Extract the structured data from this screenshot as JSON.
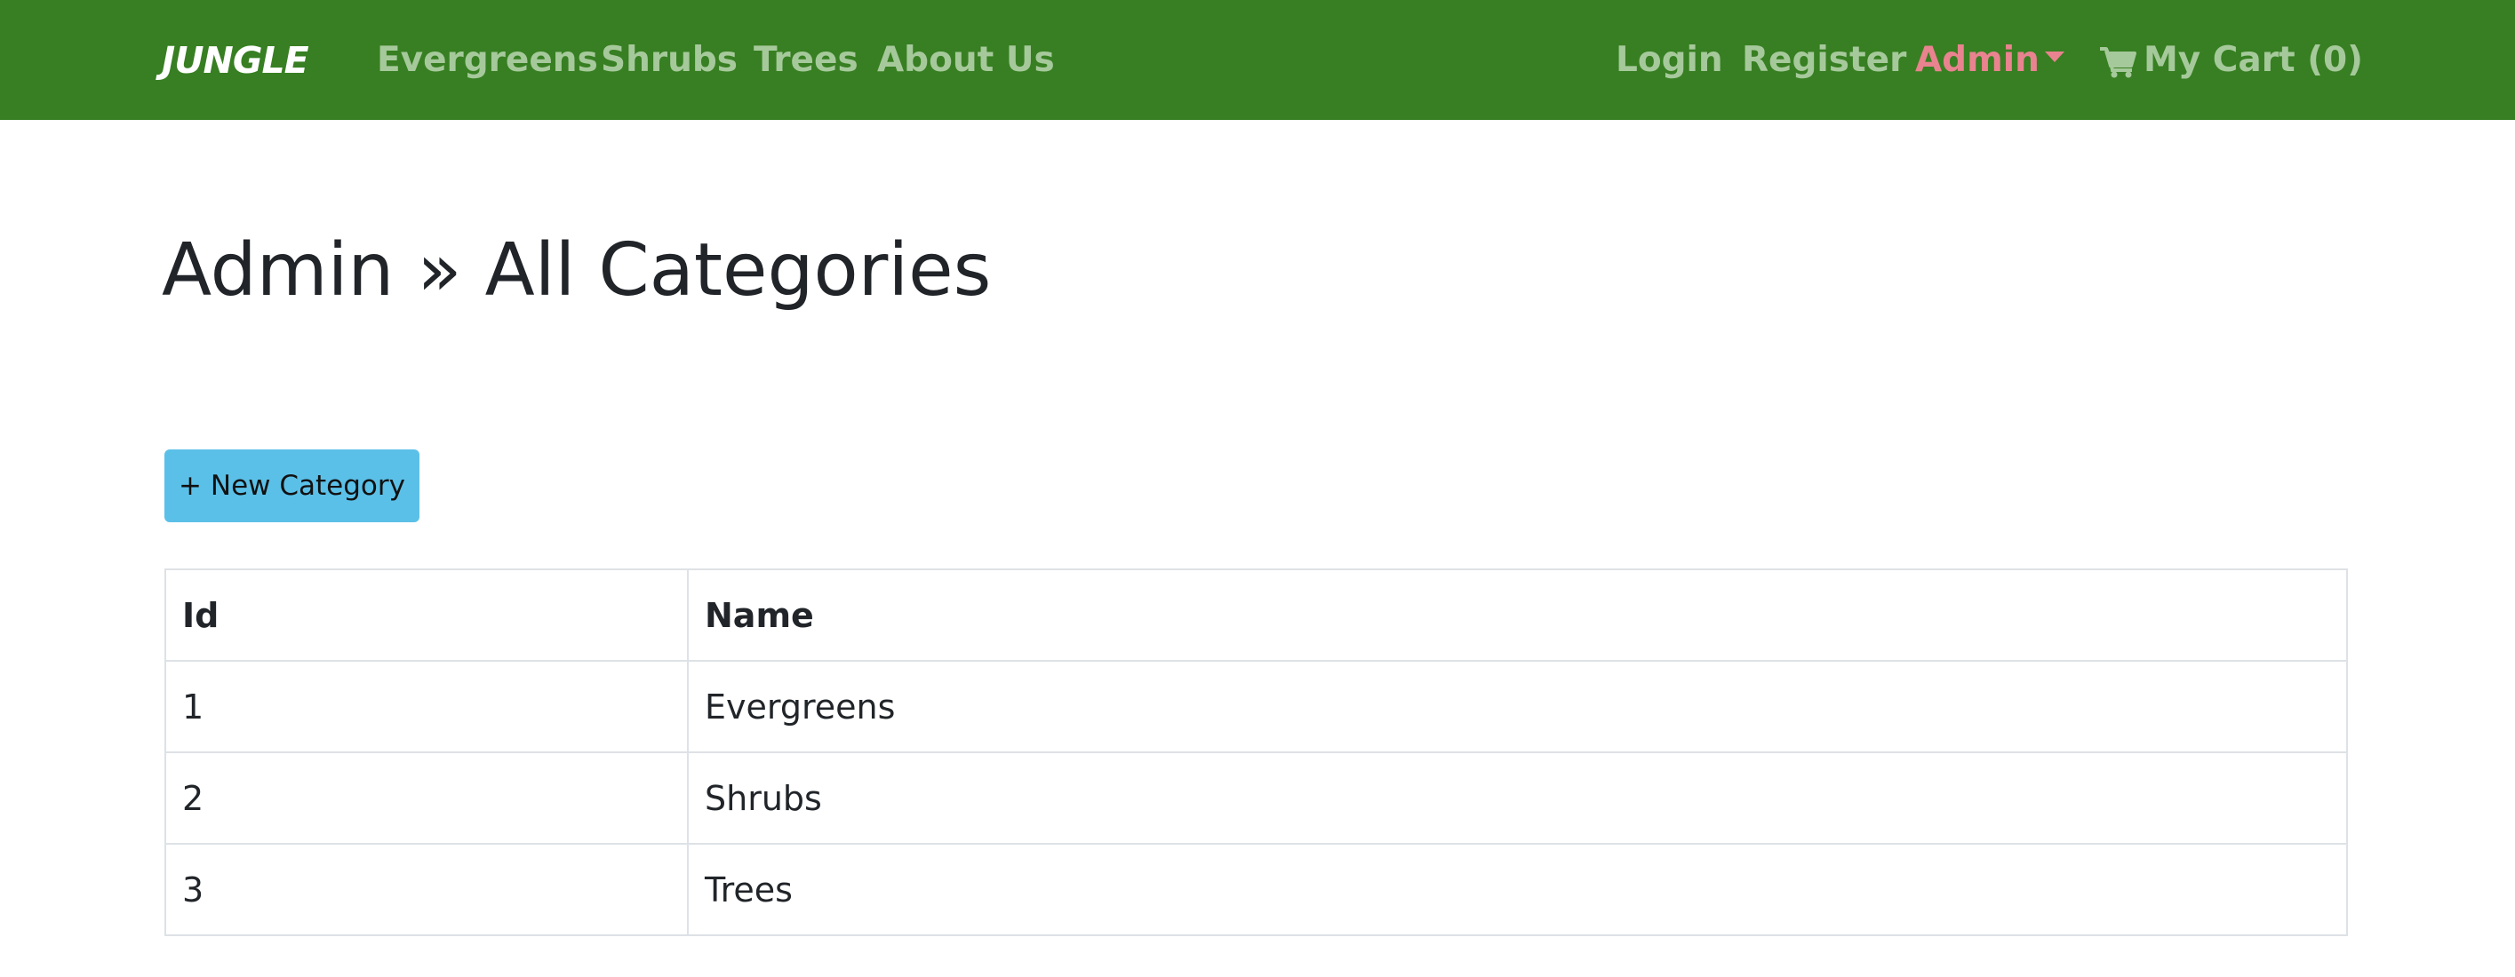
{
  "navbar": {
    "brand": "JUNGLE",
    "links_left": [
      {
        "label": "Evergreens"
      },
      {
        "label": "Shrubs"
      },
      {
        "label": "Trees"
      },
      {
        "label": "About Us"
      }
    ],
    "login": "Login",
    "register": "Register",
    "admin": "Admin",
    "cart": "My Cart (0)",
    "icons": {
      "cart": "shopping-cart-icon",
      "admin_dropdown": "caret-down-icon"
    },
    "colors": {
      "background": "#377f22",
      "link": "#a6c99b",
      "active": "#e9838f",
      "brand": "#ffffff"
    }
  },
  "main": {
    "title": "Admin » All Categories",
    "new_button": "+ New Category",
    "button_color": "#5bc0e8",
    "table": {
      "headers": [
        "Id",
        "Name"
      ],
      "rows": [
        [
          "1",
          "Evergreens"
        ],
        [
          "2",
          "Shrubs"
        ],
        [
          "3",
          "Trees"
        ]
      ]
    }
  }
}
